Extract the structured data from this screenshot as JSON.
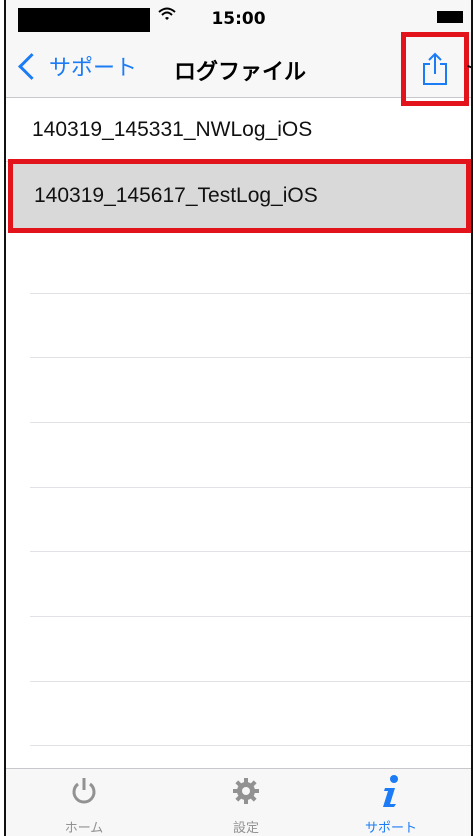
{
  "status_bar": {
    "time": "15:00",
    "wifi_icon": "wifi-icon",
    "battery_icon": "battery-icon"
  },
  "nav": {
    "back_label": "サポート",
    "title": "ログファイル",
    "share_icon": "share-icon"
  },
  "log_files": [
    "140319_145331_NWLog_iOS",
    "140319_145617_TestLog_iOS"
  ],
  "tabs": [
    {
      "label": "ホーム",
      "icon": "power-icon"
    },
    {
      "label": "設定",
      "icon": "gear-icon"
    },
    {
      "label": "サポート",
      "icon": "info-icon",
      "selected": true
    }
  ],
  "colors": {
    "accent": "#1b7cf5",
    "highlight": "#e3131b",
    "selected_row": "#d9d9d9"
  }
}
